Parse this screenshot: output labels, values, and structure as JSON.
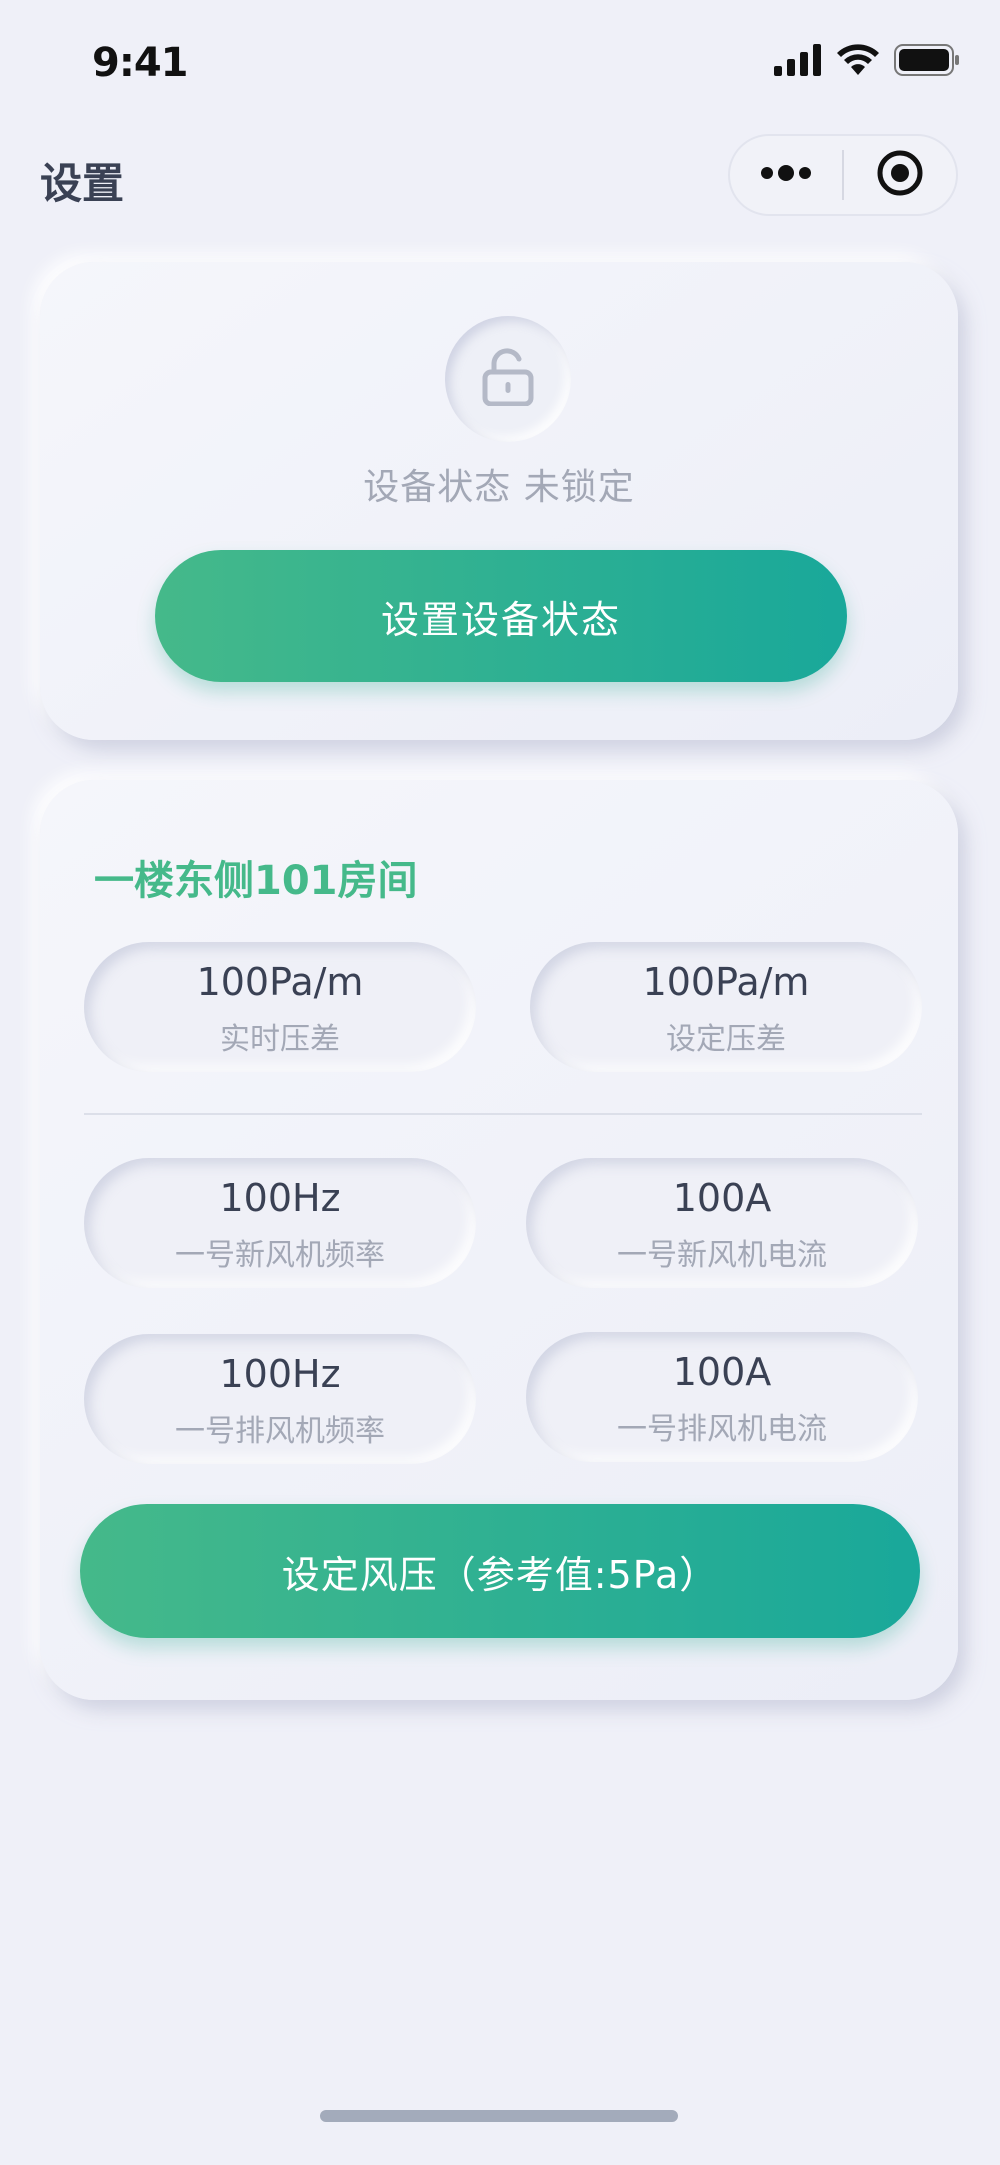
{
  "status_bar": {
    "time": "9:41",
    "icons": [
      "cellular-signal-icon",
      "wifi-icon",
      "battery-icon"
    ]
  },
  "nav": {
    "title": "设置",
    "capsule_icons": [
      "more-dots-icon",
      "record-target-icon"
    ]
  },
  "lock_card": {
    "icon": "unlock-icon",
    "status_text": "设备状态 未锁定",
    "button_label": "设置设备状态"
  },
  "room_card": {
    "title": "一楼东侧101房间",
    "metrics": [
      {
        "value": "100Pa/m",
        "label": "实时压差"
      },
      {
        "value": "100Pa/m",
        "label": "设定压差"
      },
      {
        "value": "100Hz",
        "label": "一号新风机频率"
      },
      {
        "value": "100A",
        "label": "一号新风机电流"
      },
      {
        "value": "100Hz",
        "label": "一号排风机频率"
      },
      {
        "value": "100A",
        "label": "一号排风机电流"
      }
    ],
    "button_label": "设定风压（参考值:5Pa）"
  },
  "colors": {
    "accent_green": "#45b98a",
    "accent_teal": "#19a89a",
    "background": "#eff0f8",
    "text_dark": "#3a4154",
    "text_muted": "#a3a8b6"
  }
}
